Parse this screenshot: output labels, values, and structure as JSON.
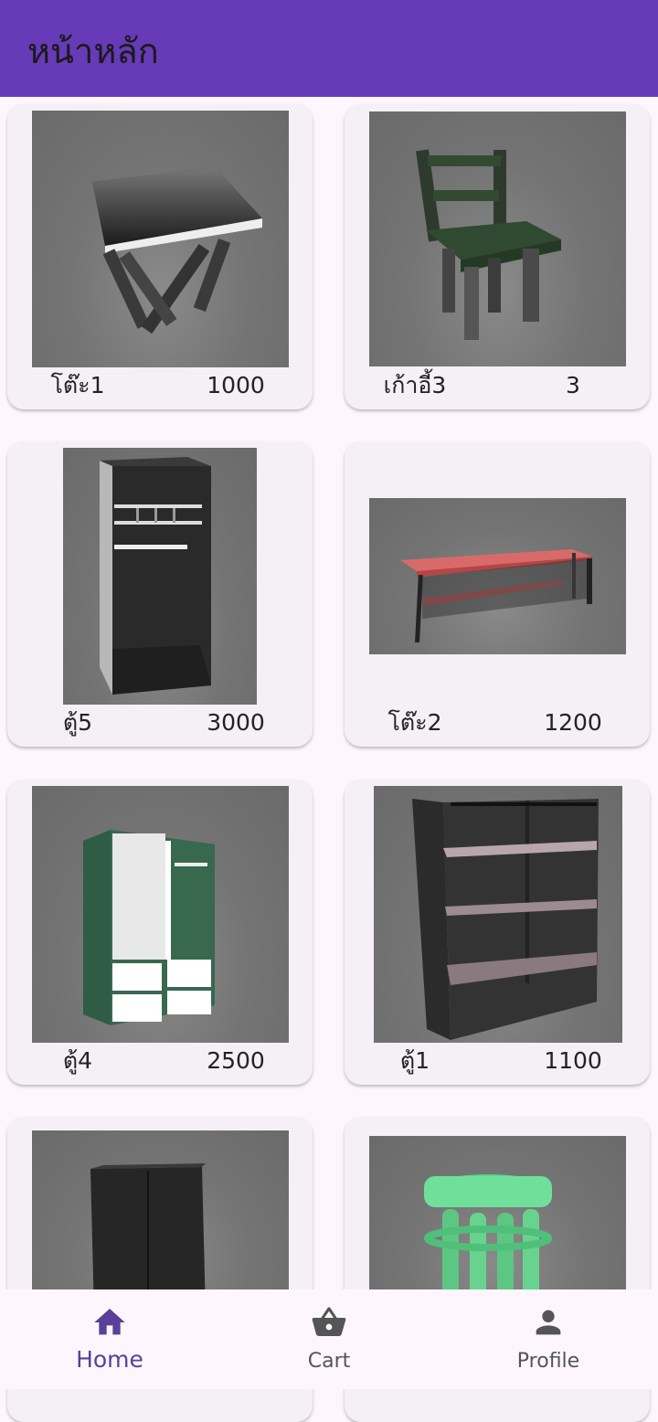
{
  "appbar": {
    "title": "หน้าหลัก"
  },
  "products": [
    {
      "name": "โต๊ะ1",
      "price": "1000",
      "image": "folding-table-image"
    },
    {
      "name": "เก้าอี้3",
      "price": "3",
      "image": "chair-image"
    },
    {
      "name": "ตู้5",
      "price": "3000",
      "image": "wardrobe-image"
    },
    {
      "name": "โต๊ะ2",
      "price": "1200",
      "image": "red-shelf-table-image"
    },
    {
      "name": "ตู้4",
      "price": "2500",
      "image": "green-wardrobe-image"
    },
    {
      "name": "ตู้1",
      "price": "1100",
      "image": "bookshelf-image"
    },
    {
      "name": "",
      "price": "",
      "image": "dark-cabinet-image"
    },
    {
      "name": "",
      "price": "",
      "image": "green-stool-image"
    }
  ],
  "nav": {
    "home": {
      "label": "Home",
      "icon": "home-icon"
    },
    "cart": {
      "label": "Cart",
      "icon": "basket-icon"
    },
    "profile": {
      "label": "Profile",
      "icon": "person-icon"
    }
  },
  "colors": {
    "primary": "#673ab7",
    "active_nav": "#5b3f99"
  }
}
